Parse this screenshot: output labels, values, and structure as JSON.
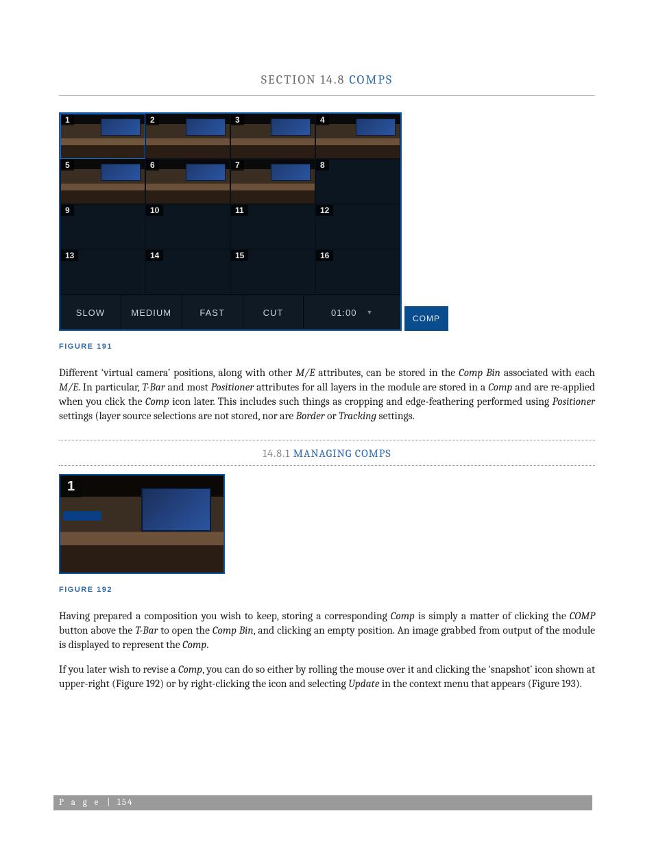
{
  "section": {
    "number": "SECTION 14.8",
    "name": "COMPS"
  },
  "subsection": {
    "number": "14.8.1",
    "name": "MANAGING COMPS"
  },
  "figure191": {
    "caption": "FIGURE 191",
    "cells": [
      {
        "n": "1",
        "filled": true,
        "sel": true
      },
      {
        "n": "2",
        "filled": true
      },
      {
        "n": "3",
        "filled": true
      },
      {
        "n": "4",
        "filled": true
      },
      {
        "n": "5",
        "filled": true
      },
      {
        "n": "6",
        "filled": true
      },
      {
        "n": "7",
        "filled": true
      },
      {
        "n": "8",
        "filled": false
      },
      {
        "n": "9",
        "filled": false
      },
      {
        "n": "10",
        "filled": false
      },
      {
        "n": "11",
        "filled": false
      },
      {
        "n": "12",
        "filled": false
      },
      {
        "n": "13",
        "filled": false
      },
      {
        "n": "14",
        "filled": false
      },
      {
        "n": "15",
        "filled": false
      },
      {
        "n": "16",
        "filled": false
      }
    ],
    "buttons": {
      "slow": "SLOW",
      "medium": "MEDIUM",
      "fast": "FAST",
      "cut": "CUT",
      "time": "01:00"
    },
    "comp_label": "COMP"
  },
  "figure192": {
    "caption": "FIGURE 192",
    "corner": "1"
  },
  "para1": {
    "t1": "Different ‘virtual camera’ positions, along with other ",
    "i1": "M/E",
    "t2": " attributes, can be stored in the ",
    "i2": "Comp Bin",
    "t3": " associated with each ",
    "i3": "M/E",
    "t4": ".   In particular, ",
    "i4": "T-Bar",
    "t5": " and most ",
    "i5": "Positioner",
    "t6": " attributes for all layers in the module are stored in a ",
    "i6": "Comp",
    "t7": " and are re-applied when you click the ",
    "i7": "Comp",
    "t8": " icon later.  This includes such things as cropping and edge-feathering performed using ",
    "i8": "Positioner",
    "t9": " settings (layer source selections are not stored, nor are ",
    "i9": "Border",
    "t10": " or ",
    "i10": "Tracking",
    "t11": " settings."
  },
  "para2": {
    "t1": "Having prepared a composition you wish to keep, storing a corresponding ",
    "i1": "Comp",
    "t2": " is simply a matter of clicking the ",
    "i2": "COMP",
    "t3": " button above the ",
    "i3": "T-Bar",
    "t4": " to open the ",
    "i4": "Comp Bin",
    "t5": ", and clicking an empty position.  An image grabbed from output of the module is displayed to represent the ",
    "i5": "Comp",
    "t6": "."
  },
  "para3": {
    "t1": "If you later wish to revise a ",
    "i1": "Comp",
    "t2": ", you can do so either by rolling the mouse over it and clicking the ‘snapshot’ icon shown at upper-right (Figure 192) or by right-clicking the icon and selecting ",
    "i2": "Update",
    "t3": " in the context menu that appears (Figure 193)."
  },
  "footer": {
    "label": "P a g e",
    "sep": "  |  ",
    "num": "154"
  }
}
